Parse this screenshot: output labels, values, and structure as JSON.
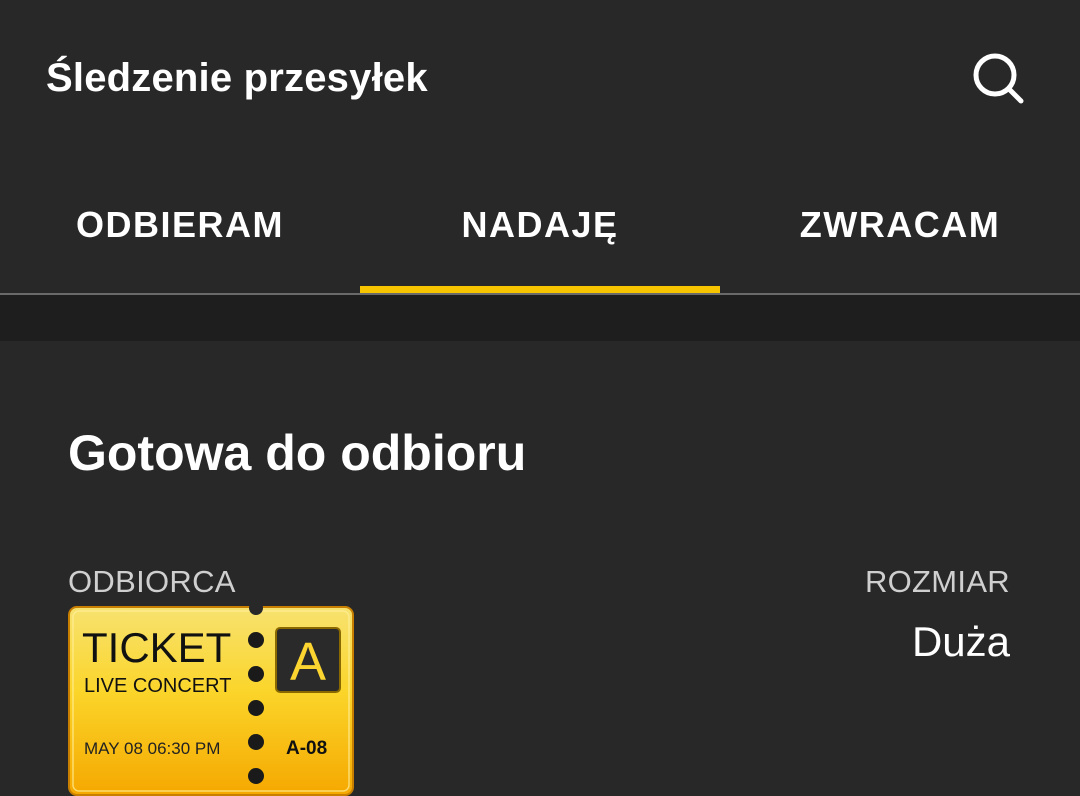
{
  "appbar": {
    "title": "Śledzenie przesyłek",
    "search_icon": "search-icon"
  },
  "tabs": [
    {
      "label": "ODBIERAM",
      "active": false
    },
    {
      "label": "NADAJĘ",
      "active": true
    },
    {
      "label": "ZWRACAM",
      "active": false
    }
  ],
  "colors": {
    "background": "#282828",
    "band": "#1e1e1e",
    "accent": "#f7c400",
    "label": "#cfcfcf"
  },
  "parcel": {
    "status_title": "Gotowa do odbioru",
    "recipient_label": "ODBIORCA",
    "size_label": "ROZMIAR",
    "size_value": "Duża",
    "recipient_icon": "ticket-icon",
    "ticket": {
      "title": "TICKET",
      "subtitle": "LIVE CONCERT",
      "badge": "A",
      "date": "MAY 08 06:30 PM",
      "seat": "A-08"
    }
  }
}
